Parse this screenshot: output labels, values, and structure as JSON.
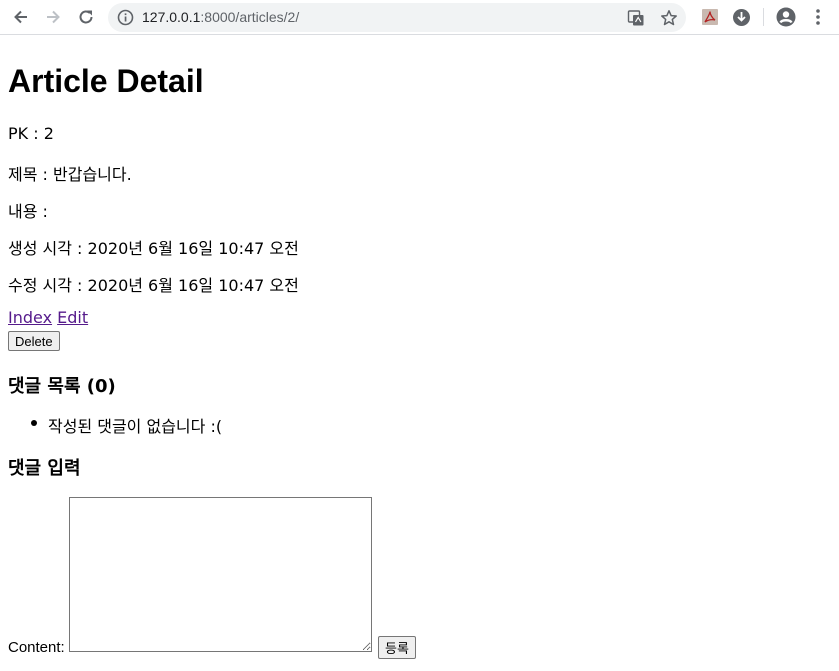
{
  "browser": {
    "url_host": "127.0.0.1",
    "url_rest": ":8000/articles/2/"
  },
  "page": {
    "title": "Article Detail",
    "pk": "PK : 2",
    "subject": "제목 : 반갑습니다.",
    "body": "내용 :",
    "created": "생성 시각 : 2020년 6월 16일 10:47 오전",
    "updated": "수정 시각 : 2020년 6월 16일 10:47 오전",
    "links": {
      "index": "Index",
      "edit": "Edit"
    },
    "delete_label": "Delete"
  },
  "comments": {
    "heading": "댓글 목록 (0)",
    "empty_message": "작성된 댓글이 없습니다 :(",
    "form_heading": "댓글 입력",
    "content_label": "Content:",
    "content_value": "",
    "submit_label": "등록"
  },
  "colors": {
    "link_visited": "#551a8b",
    "toolbar_icon": "#5f6368",
    "omnibox_bg": "#f1f3f4"
  }
}
